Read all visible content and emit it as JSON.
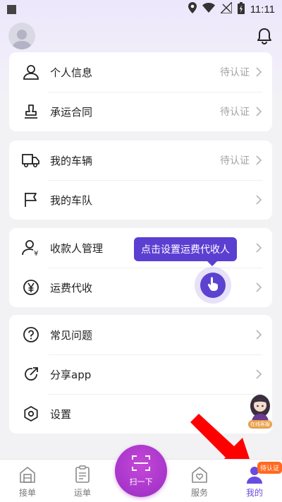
{
  "status_bar": {
    "time": "11:11",
    "icons": [
      "location-icon",
      "wifi-icon",
      "no-signal-icon",
      "battery-icon"
    ]
  },
  "header": {
    "avatar": "avatar-icon",
    "bell": "bell-icon"
  },
  "cards": [
    {
      "rows": [
        {
          "icon": "user-icon",
          "label": "个人信息",
          "status": "待认证"
        },
        {
          "icon": "stamp-icon",
          "label": "承运合同",
          "status": "待认证"
        }
      ]
    },
    {
      "rows": [
        {
          "icon": "truck-icon",
          "label": "我的车辆",
          "status": "待认证"
        },
        {
          "icon": "flag-icon",
          "label": "我的车队",
          "status": ""
        }
      ]
    },
    {
      "rows": [
        {
          "icon": "payee-icon",
          "label": "收款人管理",
          "status": ""
        },
        {
          "icon": "yen-icon",
          "label": "运费代收",
          "status": ""
        }
      ]
    },
    {
      "rows": [
        {
          "icon": "question-icon",
          "label": "常见问题",
          "status": ""
        },
        {
          "icon": "share-icon",
          "label": "分享app",
          "status": ""
        },
        {
          "icon": "settings-icon",
          "label": "设置",
          "status": ""
        }
      ]
    }
  ],
  "tooltip": {
    "text": "点击设置运费代收人"
  },
  "customer_service": {
    "label": "在线客服"
  },
  "bottom_nav": {
    "items": [
      {
        "icon": "order-icon",
        "label": "接单"
      },
      {
        "icon": "waybill-icon",
        "label": "运单"
      },
      {
        "icon": "service-icon",
        "label": "服务"
      },
      {
        "icon": "me-icon",
        "label": "我的"
      }
    ],
    "scan_label": "扫一下",
    "pending_badge": "待认证"
  },
  "colors": {
    "accent": "#6a4be0",
    "tooltip_bg": "#5b3fd1",
    "scan_button": "#b43ad2",
    "badge": "#ff6a1f",
    "annotation_arrow": "#ff0000"
  }
}
